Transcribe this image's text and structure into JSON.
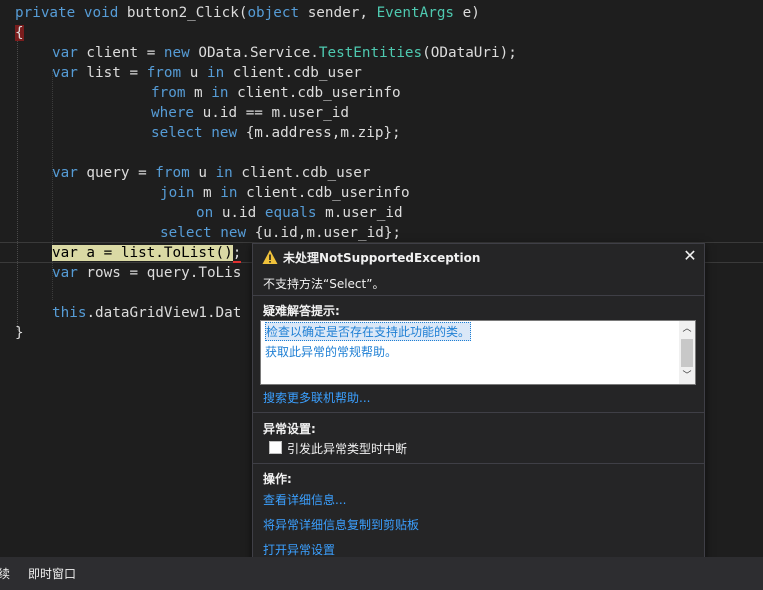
{
  "code": {
    "line1": {
      "k1": "private",
      "k2": "void",
      "t1": " button2_Click(",
      "k3": "object",
      "t2": " sender, ",
      "ty": "EventArgs",
      "t3": " e)"
    },
    "line2": {
      "brace": "{"
    },
    "line3": {
      "k1": "var",
      "t1": " client = ",
      "k2": "new",
      "t2": " OData.Service.",
      "ty": "TestEntities",
      "t3": "(ODataUri);"
    },
    "line4": {
      "k1": "var",
      "t1": " list = ",
      "k2": "from",
      "t2": " u ",
      "k3": "in",
      "t3": " client.cdb_user"
    },
    "line5": {
      "k1": "from",
      "t1": " m ",
      "k2": "in",
      "t2": " client.cdb_userinfo"
    },
    "line6": {
      "k1": "where",
      "t1": " u.id == m.user_id"
    },
    "line7": {
      "k1": "select",
      "t1": " ",
      "k2": "new",
      "t2": " {m.address,m.zip};"
    },
    "line8": {
      "k1": "var",
      "t1": " query = ",
      "k2": "from",
      "t2": " u ",
      "k3": "in",
      "t3": " client.cdb_user"
    },
    "line9": {
      "k1": "join",
      "t1": " m ",
      "k2": "in",
      "t2": " client.cdb_userinfo"
    },
    "line10": {
      "k1": "on",
      "t1": " u.id ",
      "k2": "equals",
      "t2": " m.user_id"
    },
    "line11": {
      "k1": "select",
      "t1": " ",
      "k2": "new",
      "t2": " {u.id,m.user_id};"
    },
    "line12": {
      "hl": "var a = list.ToList()",
      "t1": ";"
    },
    "line13": {
      "k1": "var",
      "t1": " rows = query.ToLis"
    },
    "line14": {
      "k1": "this",
      "t1": ".dataGridView1.Dat"
    },
    "line15": {
      "brace": "}"
    }
  },
  "popup": {
    "title": "未处理NotSupportedException",
    "message": "不支持方法“Select”。",
    "hints_header": "疑难解答提示:",
    "hints": [
      "检查以确定是否存在支持此功能的类。",
      "获取此异常的常规帮助。"
    ],
    "search_more": "搜索更多联机帮助...",
    "exception_settings_header": "异常设置:",
    "break_checkbox_label": "引发此异常类型时中断",
    "break_checked": false,
    "actions_header": "操作:",
    "actions": [
      "查看详细信息...",
      "将异常详细信息复制到剪贴板",
      "打开异常设置"
    ]
  },
  "bottom_tabs": [
    "续",
    "即时窗口"
  ],
  "colors": {
    "keyword": "#569cd6",
    "type": "#4ec9b0",
    "link": "#3ba0ff",
    "editor_bg": "#1e1e1e",
    "popup_bg": "#252526"
  }
}
